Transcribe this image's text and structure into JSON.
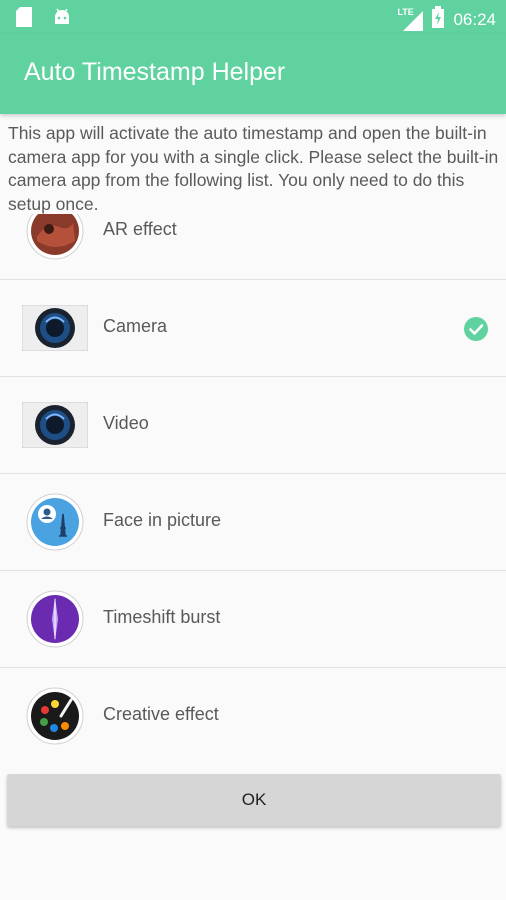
{
  "status_bar": {
    "network": "LTE",
    "time": "06:24",
    "left_icons": [
      "sd-card-icon",
      "android-icon"
    ],
    "right_icons": [
      "signal-icon",
      "battery-icon"
    ]
  },
  "app_bar": {
    "title": "Auto Timestamp Helper"
  },
  "intro_text": "This app will activate the auto timestamp and open the built-in camera app for you with a single click. Please select the built-in camera app from the following list. You only need to do this setup once.",
  "apps": [
    {
      "label": "AR effect",
      "icon": "ar-effect-icon",
      "selected": false
    },
    {
      "label": "Camera",
      "icon": "camera-app-icon",
      "selected": true
    },
    {
      "label": "Video",
      "icon": "video-app-icon",
      "selected": false
    },
    {
      "label": "Face in picture",
      "icon": "face-in-picture-icon",
      "selected": false
    },
    {
      "label": "Timeshift burst",
      "icon": "timeshift-burst-icon",
      "selected": false
    },
    {
      "label": "Creative effect",
      "icon": "creative-effect-icon",
      "selected": false
    }
  ],
  "ok_button": {
    "label": "OK"
  },
  "colors": {
    "accent": "#5fd2a0",
    "button_bg": "#d6d6d6"
  }
}
